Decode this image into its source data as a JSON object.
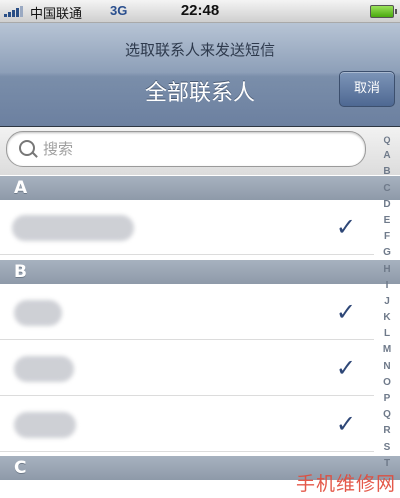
{
  "status_bar": {
    "carrier": "中国联通",
    "network": "3G",
    "time": "22:48"
  },
  "nav": {
    "prompt": "选取联系人来发送短信",
    "title": "全部联系人",
    "cancel_label": "取消"
  },
  "search": {
    "placeholder": "搜索",
    "value": ""
  },
  "sections": [
    {
      "letter": "A"
    },
    {
      "letter": "B"
    },
    {
      "letter": "C"
    }
  ],
  "check_mark": "✓",
  "index_items": [
    "Q",
    "A",
    "B",
    "C",
    "D",
    "E",
    "F",
    "G",
    "H",
    "I",
    "J",
    "K",
    "L",
    "M",
    "N",
    "O",
    "P",
    "Q",
    "R",
    "S",
    "T"
  ],
  "watermark": "手机维修网",
  "colors": {
    "nav_top": "#b7c4d5",
    "nav_bottom": "#6c80a0",
    "check": "#2e4777",
    "section": "#9aa5b3",
    "watermark": "#e24b3b"
  }
}
